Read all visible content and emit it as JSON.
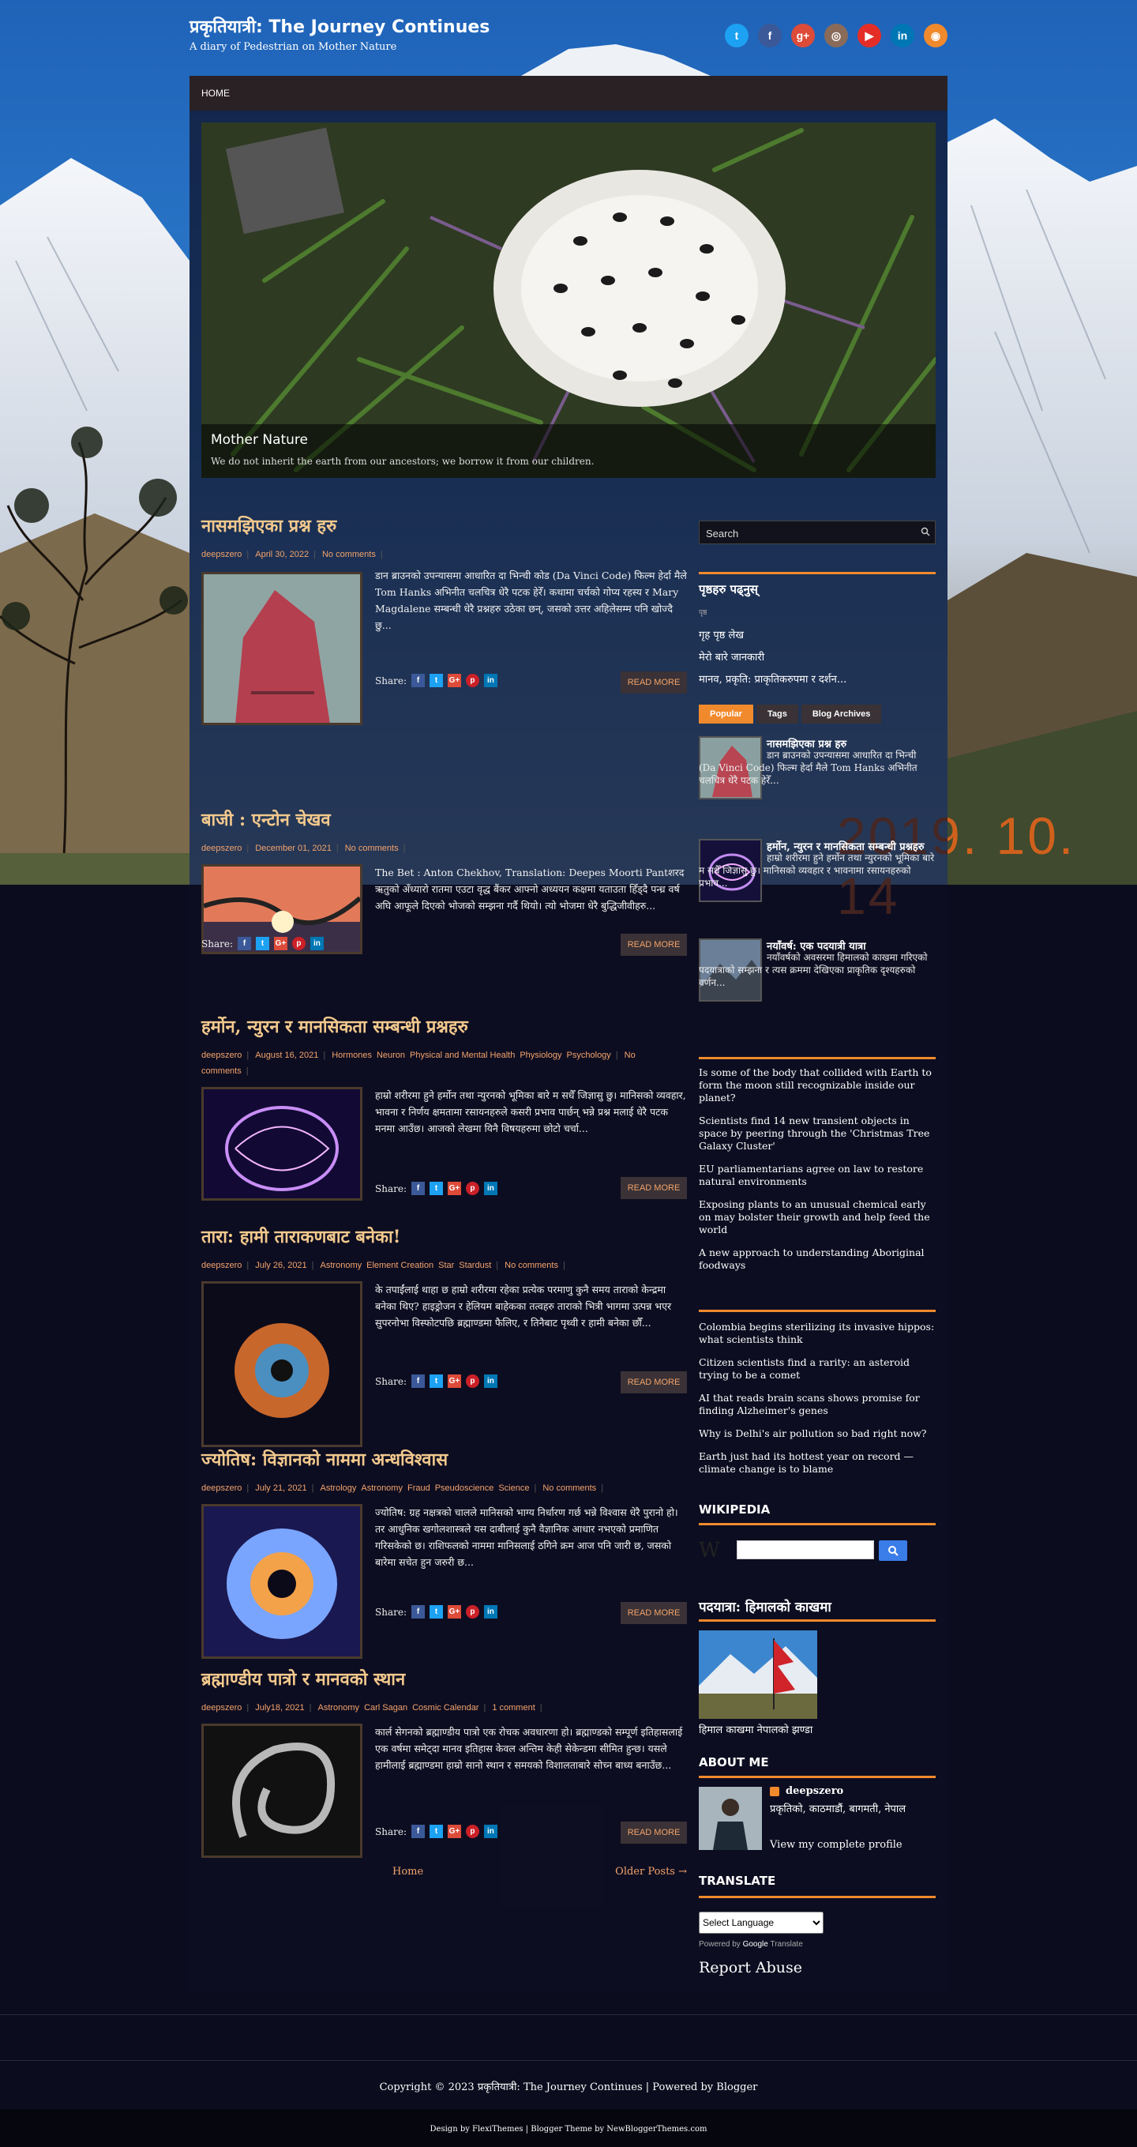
{
  "site": {
    "title": "प्रकृतियात्री: The Journey Continues",
    "description": "A diary of Pedestrian on Mother Nature",
    "date_stamp": "2019. 10. 14"
  },
  "social": [
    {
      "name": "twitter",
      "glyph": "t",
      "color": "#1da1f2"
    },
    {
      "name": "facebook",
      "glyph": "f",
      "color": "#3b5998"
    },
    {
      "name": "google-plus",
      "glyph": "g+",
      "color": "#dd4b39"
    },
    {
      "name": "instagram",
      "glyph": "◎",
      "color": "#8a6b5a"
    },
    {
      "name": "youtube",
      "glyph": "▶",
      "color": "#e52d27"
    },
    {
      "name": "linkedin",
      "glyph": "in",
      "color": "#0077b5"
    },
    {
      "name": "rss",
      "glyph": "◉",
      "color": "#f08a2c"
    }
  ],
  "nav": {
    "home": "HOME"
  },
  "slider": {
    "title": "Mother Nature",
    "text": "We do not inherit the earth from our ancestors; we borrow it from our children."
  },
  "posts": [
    {
      "title": "नासमझिएका प्रश्न हरु",
      "author": "deepszero",
      "date": "April 30, 2022",
      "labels": [],
      "comments": "No comments",
      "excerpt": "डान ब्राउनको उपन्यासमा आधारित दा भिन्ची कोड (Da Vinci Code) फिल्म हेर्दा मैले Tom Hanks अभिनीत चलचित्र धेरै पटक हेरेँ। कथामा चर्चको गोप्य रहस्य र Mary Magdalene सम्बन्धी धेरै प्रश्नहरु उठेका छन्, जसको उत्तर अहिलेसम्म पनि खोज्दै छु...",
      "share": "Share:",
      "more": "READ MORE"
    },
    {
      "title": "बाजी : एन्टोन चेखव",
      "author": "deepszero",
      "date": "December 01, 2021",
      "labels": [],
      "comments": "No comments",
      "excerpt": " The Bet : Anton Chekhov, Translation: Deepes Moorti Pantशरद ऋतुको अँध्यारो रातमा एउटा वृद्ध बैंकर आफ्नो अध्ययन कक्षमा यताउता हिँड्दै पन्ध्र वर्ष अघि आफूले दिएको भोजको सम्झना गर्दै थियो। त्यो भोजमा धेरै बुद्धिजीवीहरु...",
      "share": "Share:",
      "more": "READ MORE"
    },
    {
      "title": "हर्मोन, न्युरन र मानसिकता सम्बन्धी प्रश्नहरु",
      "author": "deepszero",
      "date": "August 16, 2021",
      "labels": [
        "Hormones",
        "Neuron",
        "Physical and Mental Health",
        "Physiology",
        "Psychology"
      ],
      "comments": "No comments",
      "excerpt": " हाम्रो शरीरमा हुने हर्मोन तथा न्युरनको भूमिका बारे म सधैँ जिज्ञासु छु। मानिसको व्यवहार, भावना र निर्णय क्षमतामा रसायनहरुले कसरी प्रभाव पार्छन् भन्ने प्रश्न मलाई धेरै पटक मनमा आउँछ। आजको लेखमा यिनै विषयहरुमा छोटो चर्चा...",
      "share": "Share:",
      "more": "READ MORE"
    },
    {
      "title": "तारा: हामी ताराकणबाट बनेका!",
      "author": "deepszero",
      "date": "July 26, 2021",
      "labels": [
        "Astronomy",
        "Element Creation",
        "Star",
        "Stardust"
      ],
      "comments": "No comments",
      "excerpt": "के तपाईंलाई थाहा छ हाम्रो शरीरमा रहेका प्रत्येक परमाणु कुनै समय ताराको केन्द्रमा बनेका थिए? हाइड्रोजन र हेलियम बाहेकका तत्वहरु ताराको भित्री भागमा उत्पन्न भएर सुपरनोभा विस्फोटपछि ब्रह्माण्डमा फैलिए, र तिनैबाट पृथ्वी र हामी बनेका छौँ...",
      "share": "Share:",
      "more": "READ MORE"
    },
    {
      "title": "ज्योतिष: विज्ञानको नाममा अन्धविश्वास",
      "author": "deepszero",
      "date": "July 21, 2021",
      "labels": [
        "Astrology",
        "Astronomy",
        "Fraud",
        "Pseudoscience",
        "Science"
      ],
      "comments": "No comments",
      "excerpt": "ज्योतिष: ग्रह नक्षत्रको चालले मानिसको भाग्य निर्धारण गर्छ भन्ने विश्वास धेरै पुरानो हो। तर आधुनिक खगोलशास्त्रले यस दाबीलाई कुनै वैज्ञानिक आधार नभएको प्रमाणित गरिसकेको छ। राशिफलको नाममा मानिसलाई ठगिने क्रम आज पनि जारी छ, जसको बारेमा सचेत हुन जरुरी छ...",
      "share": "Share:",
      "more": "READ MORE"
    },
    {
      "title": "ब्रह्माण्डीय पात्रो र मानवको स्थान",
      "author": "deepszero",
      "date": "July18, 2021",
      "labels": [
        "Astronomy",
        "Carl Sagan",
        "Cosmic Calendar"
      ],
      "comments": "1 comment",
      "excerpt": "कार्ल सेगनको ब्रह्माण्डीय पात्रो एक रोचक अवधारणा हो। ब्रह्माण्डको सम्पूर्ण इतिहासलाई एक वर्षमा समेट्दा मानव इतिहास केवल अन्तिम केही सेकेन्डमा सीमित हुन्छ। यसले हामीलाई ब्रह्माण्डमा हाम्रो सानो स्थान र समयको विशालताबारे सोच्न बाध्य बनाउँछ...",
      "share": "Share:",
      "more": "READ MORE"
    }
  ],
  "pager": {
    "home": "Home",
    "older": "Older Posts →"
  },
  "sidebar": {
    "search_placeholder": "Search",
    "pages": {
      "heading": "पृष्ठहरु पढ्नुस्",
      "small": "पृष्ठ",
      "items": [
        "गृह पृष्ठ लेख",
        "मेरो बारे जानकारी",
        "मानव, प्रकृति: प्राकृतिकरुपमा र दर्शन..."
      ]
    },
    "tabs": [
      "Popular",
      "Tags",
      "Blog Archives"
    ],
    "popular": [
      {
        "title": "नासमझिएका प्रश्न हरु",
        "excerpt": "डान ब्राउनको उपन्यासमा आधारित दा भिन्ची (Da Vinci Code) फिल्म हेर्दा मैले Tom Hanks अभिनीत चलचित्र धेरै पटक हेरेँ..."
      },
      {
        "title": "हर्मोन, न्युरन र मानसिकता सम्बन्धी प्रश्नहरु",
        "excerpt": "हाम्रो शरीरमा हुने हर्मोन तथा न्युरनको भूमिका बारे म सधैँ जिज्ञासु छु। मानिसको व्यवहार र भावनामा रसायनहरुको प्रभाव..."
      },
      {
        "title": "नयाँवर्ष: एक पदयात्री यात्रा",
        "excerpt": "नयाँवर्षको अवसरमा हिमालको काखमा गरिएको पदयात्राको सम्झना र त्यस क्रममा देखिएका प्राकृतिक दृश्यहरुको वर्णन..."
      }
    ],
    "feed1": [
      "Is some of the body that collided with Earth to form the moon still recognizable inside our planet?",
      "Scientists find 14 new transient objects in space by peering through the 'Christmas Tree Galaxy Cluster'",
      "EU parliamentarians agree on law to restore natural environments",
      "Exposing plants to an unusual chemical early on may bolster their growth and help feed the world",
      "A new approach to understanding Aboriginal foodways"
    ],
    "feed2": [
      "Colombia begins sterilizing its invasive hippos: what scientists think",
      "Citizen scientists find a rarity: an asteroid trying to be a comet",
      "AI that reads brain scans shows promise for finding Alzheimer's genes",
      "Why is Delhi's air pollution so bad right now?",
      "Earth just had its hottest year on record — climate change is to blame"
    ],
    "wiki_heading": "WIKIPEDIA",
    "wiki_logo": "W",
    "featured": {
      "heading": "पदयात्रा: हिमालको काखमा",
      "caption": "हिमाल काखमा नेपालको झण्डा"
    },
    "about": {
      "heading": "ABOUT ME",
      "name": "deepszero",
      "location": "प्रकृतिको, काठमाडौं, बागमती, नेपाल",
      "profile": "View my complete profile"
    },
    "translate": {
      "heading": "TRANSLATE",
      "select": "Select Language",
      "powered": "Powered by",
      "google": "Google",
      "tr": "Translate"
    },
    "report": "Report Abuse"
  },
  "footer": {
    "copyright": "Copyright © 2023 प्रकृतियात्री: The Journey Continues | Powered by Blogger",
    "credits": "Design by FlexiThemes | Blogger Theme by NewBloggerThemes.com"
  }
}
